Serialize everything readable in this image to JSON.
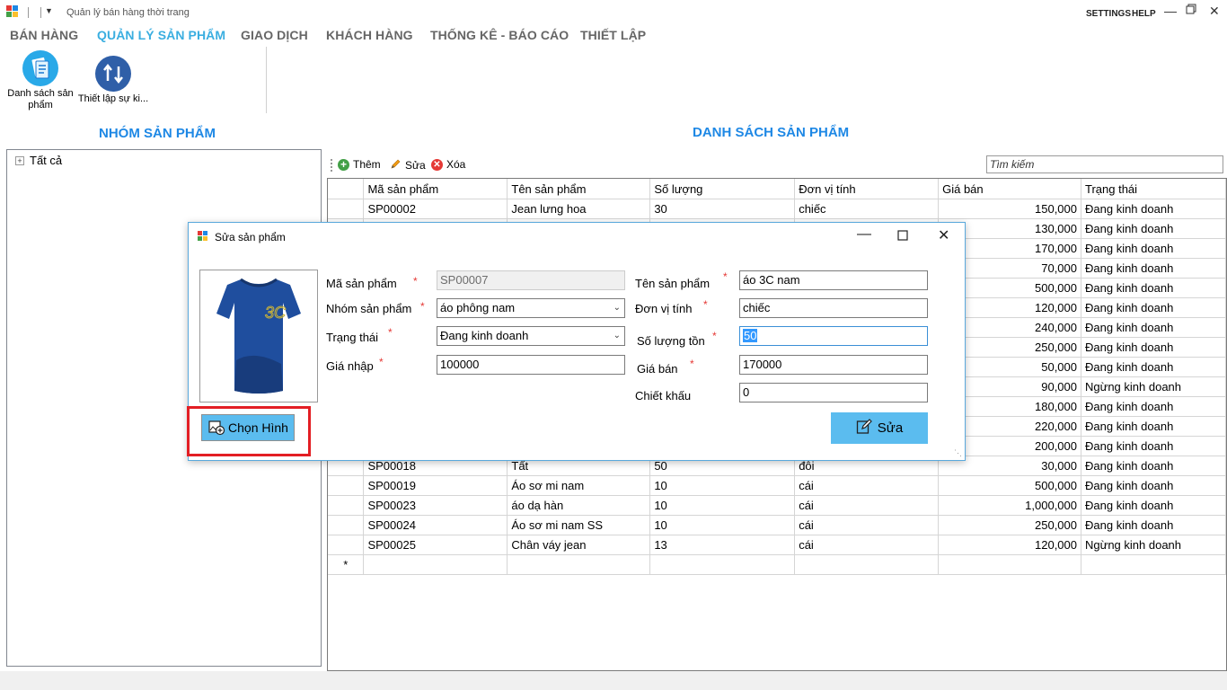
{
  "app": {
    "title": "Quản lý bán hàng thời trang",
    "settings_label": "SETTINGS",
    "help_label": "HELP"
  },
  "menu": {
    "tabs": [
      "BÁN HÀNG",
      "QUẢN LÝ SẢN PHẨM",
      "GIAO DỊCH",
      "KHÁCH HÀNG",
      "THỐNG KÊ - BÁO CÁO",
      "THIẾT LẬP"
    ],
    "active_tab": "QUẢN LÝ SẢN PHẨM"
  },
  "ribbon": {
    "product_list_label": "Danh sách sản phẩm",
    "setup_label": "Thiết lập sự ki..."
  },
  "left_panel": {
    "title": "NHÓM SẢN PHẨM",
    "tree_root": "Tất cả"
  },
  "main": {
    "title": "DANH SÁCH SẢN PHẨM",
    "toolbar": {
      "add": "Thêm",
      "edit": "Sửa",
      "delete": "Xóa"
    },
    "search_placeholder": "Tìm kiếm",
    "columns": [
      "Mã sản phẩm",
      "Tên sản phẩm",
      "Số lượng",
      "Đơn vị tính",
      "Giá bán",
      "Trạng thái"
    ],
    "rows": [
      [
        "SP00002",
        "Jean lưng hoa",
        "30",
        "chiếc",
        "150,000",
        "Đang kinh doanh"
      ],
      [
        "",
        "",
        "",
        "",
        "130,000",
        "Đang kinh doanh"
      ],
      [
        "",
        "",
        "",
        "",
        "170,000",
        "Đang kinh doanh"
      ],
      [
        "",
        "",
        "",
        "",
        "70,000",
        "Đang kinh doanh"
      ],
      [
        "",
        "",
        "",
        "",
        "500,000",
        "Đang kinh doanh"
      ],
      [
        "",
        "",
        "",
        "",
        "120,000",
        "Đang kinh doanh"
      ],
      [
        "",
        "",
        "",
        "",
        "240,000",
        "Đang kinh doanh"
      ],
      [
        "",
        "",
        "",
        "",
        "250,000",
        "Đang kinh doanh"
      ],
      [
        "",
        "",
        "",
        "",
        "50,000",
        "Đang kinh doanh"
      ],
      [
        "",
        "",
        "",
        "",
        "90,000",
        "Ngừng kinh doanh"
      ],
      [
        "",
        "",
        "",
        "",
        "180,000",
        "Đang kinh doanh"
      ],
      [
        "",
        "",
        "",
        "",
        "220,000",
        "Đang kinh doanh"
      ],
      [
        "",
        "",
        "",
        "",
        "200,000",
        "Đang kinh doanh"
      ],
      [
        "SP00018",
        "Tất",
        "50",
        "đôi",
        "30,000",
        "Đang kinh doanh"
      ],
      [
        "SP00019",
        "Áo sơ mi nam",
        "10",
        "cái",
        "500,000",
        "Đang kinh doanh"
      ],
      [
        "SP00023",
        "áo dạ hàn",
        "10",
        "cái",
        "1,000,000",
        "Đang kinh doanh"
      ],
      [
        "SP00024",
        "Áo sơ mi nam SS",
        "10",
        "cái",
        "250,000",
        "Đang kinh doanh"
      ],
      [
        "SP00025",
        "Chân váy jean",
        "13",
        "cái",
        "120,000",
        "Ngừng kinh doanh"
      ]
    ],
    "new_row_marker": "*"
  },
  "dialog": {
    "title": "Sửa sản phẩm",
    "labels": {
      "code": "Mã sản phẩm",
      "group": "Nhóm sản phẩm",
      "status": "Trạng thái",
      "cost": "Giá nhập",
      "name": "Tên sản phẩm",
      "unit": "Đơn vị tính",
      "quantity": "Số lượng tồn",
      "price": "Giá bán",
      "discount": "Chiết khấu"
    },
    "values": {
      "code": "SP00007",
      "group": "áo phông nam",
      "status": "Đang kinh doanh",
      "cost": "100000",
      "name": "áo 3C nam",
      "unit": "chiếc",
      "quantity": "50",
      "price": "170000",
      "discount": "0"
    },
    "required_mark": "*",
    "choose_image_label": "Chọn Hình",
    "save_label": "Sửa",
    "image_icon": "tshirt-product-photo"
  },
  "colors": {
    "accent": "#3aaee0",
    "heading": "#1e88e5",
    "button": "#5bbcef",
    "required": "#e53935",
    "highlight_border": "#e31e24"
  }
}
